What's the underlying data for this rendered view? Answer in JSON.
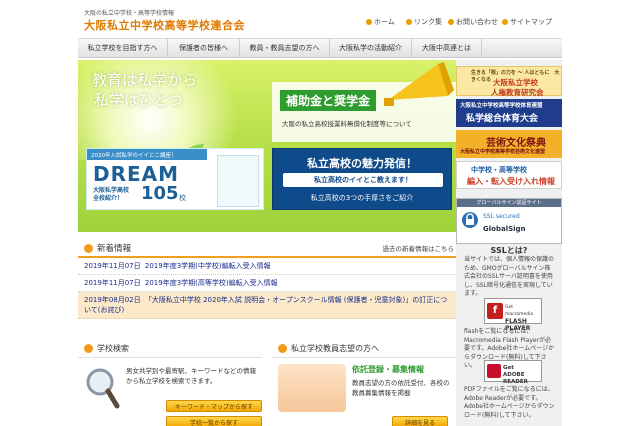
{
  "header": {
    "subtitle": "大阪の私立中学校・高等学校情報",
    "title": "大阪私立中学校高等学校連合会",
    "links": [
      "ホーム",
      "リンク集",
      "お問い合わせ",
      "サイトマップ"
    ]
  },
  "nav": {
    "items": [
      "私立学校を目指す方へ",
      "保護者の皆様へ",
      "教員・教員志望の方へ",
      "大阪私学の活動紹介",
      "大阪中高連とは"
    ]
  },
  "hero": {
    "tagline_line1": "教育は私学から",
    "tagline_line2": "私学はひとつ",
    "subsidy_title": "補助金と奨学金",
    "subsidy_text": "大阪の私立高校授業料無償化制度等について",
    "dream_top": "2020年入試私学のイイとこ講座！",
    "dream_title": "DREAM",
    "dream_label_line1": "大阪私学高校",
    "dream_label_line2": "全校紹介！",
    "dream_count": "105",
    "dream_unit": "校",
    "miryoku_title": "私立高校の魅力発信！",
    "miryoku_sub": "私立高校のイイとこ教えます！",
    "miryoku_sub2": "私立高校の3つの手厚さをご紹介"
  },
  "news": {
    "title": "新着情報",
    "archive_link": "過去の新着情報はこちら",
    "items": [
      {
        "date": "2019年11月07日",
        "text": "2019年度3学期(中学校)編転入受入情報"
      },
      {
        "date": "2019年11月07日",
        "text": "2019年度3学期(高等学校)編転入受入情報"
      },
      {
        "date": "2019年08月02日",
        "text": "「大阪私立中学校 2020年入試 説明会・オープンスクール情報 (保護者・児童対象)」の訂正について(お詫び)"
      }
    ]
  },
  "school_search": {
    "title": "学校検索",
    "text": "男女共学別や最寄駅、キーワードなどの情報から私立学校を検索できます。",
    "button_keyword": "キーワード・マップから探す",
    "button_list": "学校一覧から探す"
  },
  "teacher": {
    "title": "私立学校教員志望の方へ",
    "reg_title": "依託登録・募集情報",
    "reg_text": "教員志望の方の依託受付、各校の教員募集情報を掲載",
    "button": "詳細を見る"
  },
  "sidebar": {
    "banner1_top": "生きる「根」の力を ～ 人はともに　大きくなる",
    "banner1_line1": "大阪私立学校",
    "banner1_line2": "人権教育研究会",
    "banner2_top": "大阪私立中学校高等学校体育連盟",
    "banner2_title": "私学総合体育大会",
    "banner3_title": "芸術文化祭典",
    "banner3_sub": "大阪私立中学校高等学校芸術文化連盟",
    "banner4_line1": "中学校・高等学校",
    "banner4_line2": "編入・転入受け入れ情報",
    "ssl_head": "グローバルサイン認証サイト",
    "ssl_brand1": "SSL secured",
    "ssl_brand2": "GlobalSign",
    "ssl_q": "SSLとは?",
    "ssl_desc": "当サイトでは、個人情報の保護のため、GMOグローバルサイン株式会社のSSLサーバ証明書を使用し、SSL暗号化通信を実現しています。",
    "flash_badge_line1": "Get macromedia",
    "flash_badge_line2": "FLASH PLAYER",
    "flash_desc": "flashをご覧になるには、Macromedia Flash Playerが必要です。Adobe社ホームページからダウンロード(無料)して下さい。",
    "adobe_badge_line1": "Get",
    "adobe_badge_line2": "ADOBE READER",
    "pdf_desc": "PDFファイルをご覧になるには、Adobe Readerが必要です。Adobe社ホームページからダウンロード(無料)して下さい。"
  }
}
